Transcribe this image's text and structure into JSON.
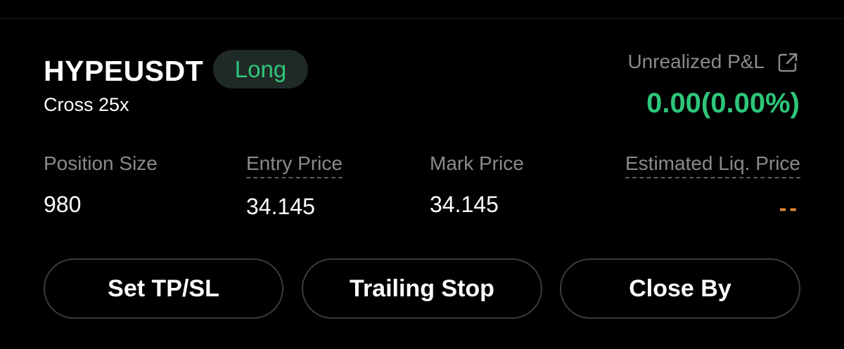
{
  "position": {
    "symbol": "HYPEUSDT",
    "side": "Long",
    "margin_mode": "Cross 25x"
  },
  "pnl": {
    "label": "Unrealized P&L",
    "value": "0.00(0.00%)",
    "icon": "share-icon"
  },
  "stats": {
    "position_size_label": "Position Size",
    "position_size_value": "980",
    "entry_price_label": "Entry Price",
    "entry_price_value": "34.145",
    "mark_price_label": "Mark Price",
    "mark_price_value": "34.145",
    "liq_price_label": "Estimated Liq. Price",
    "liq_price_value": "--"
  },
  "actions": {
    "set_tpsl_label": "Set TP/SL",
    "trailing_stop_label": "Trailing Stop",
    "close_by_label": "Close By"
  },
  "colors": {
    "background": "#000000",
    "profit_green": "#2ec67a",
    "liq_orange": "#e0882a",
    "muted_text": "#8a8a8a"
  }
}
